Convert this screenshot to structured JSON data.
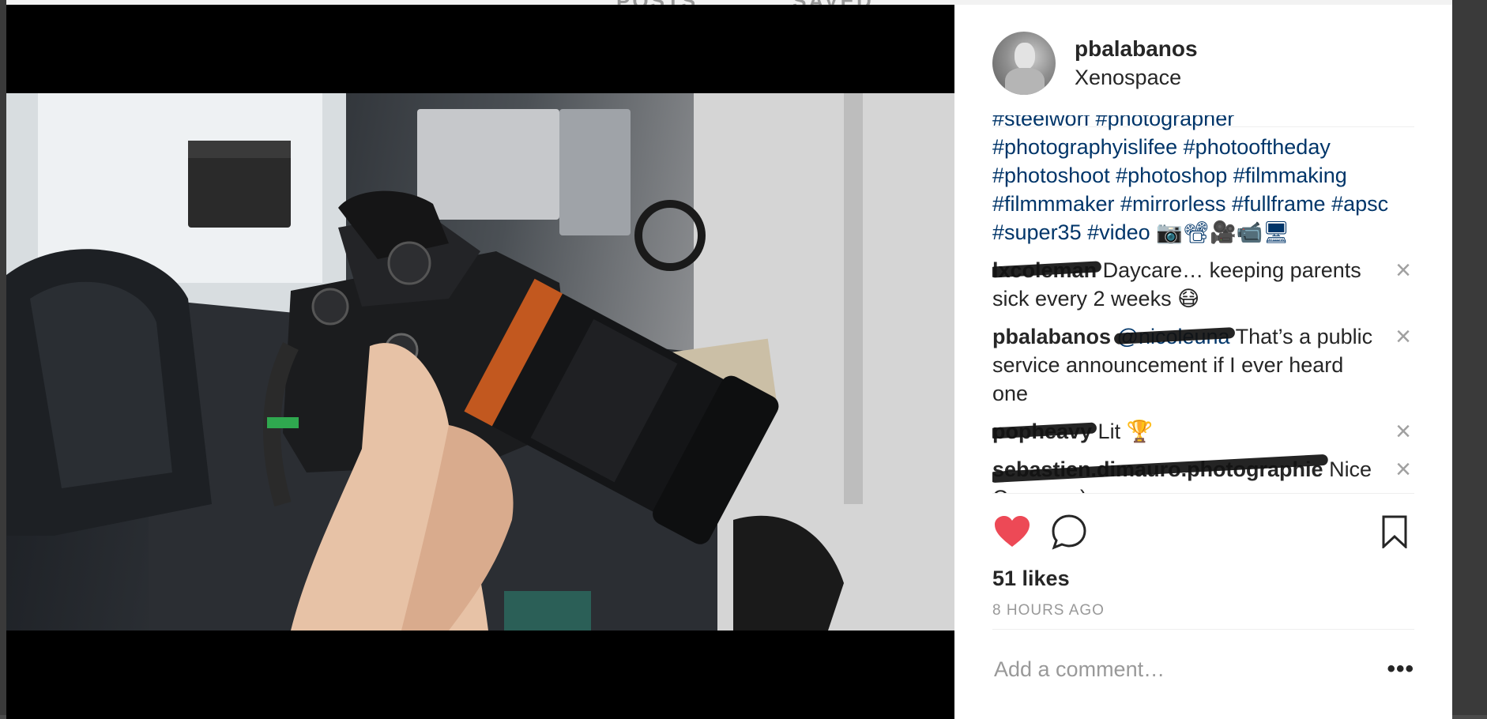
{
  "background": {
    "tabs": [
      "POSTS",
      "SAVED"
    ]
  },
  "post": {
    "username": "pbalabanos",
    "location": "Xenospace"
  },
  "caption": {
    "partial_line": "#steelworf #photographer",
    "lines": [
      "#photographyislifee #photooftheday",
      "#photoshoot #photoshop #filmmaking",
      "#filmmmaker #mirrorless #fullframe #apsc",
      "#super35 #video 📷📽🎥📹🖥"
    ]
  },
  "comments": [
    {
      "author": "lxcoleman",
      "author_redacted": true,
      "mention": "",
      "mention_redacted": false,
      "text": " Daycare… keeping parents sick every 2 weeks 😷"
    },
    {
      "author": "pbalabanos",
      "author_redacted": false,
      "mention": "@nicoleuna",
      "mention_redacted": true,
      "text": " That’s a public service announcement if I ever heard one"
    },
    {
      "author": "popheavy",
      "author_redacted": true,
      "mention": "",
      "mention_redacted": false,
      "text": " Lit 🏆"
    },
    {
      "author": "sebastien.dimauro.photographie",
      "author_redacted": true,
      "mention": "",
      "mention_redacted": false,
      "text": " Nice Camera ;)"
    }
  ],
  "actions": {
    "liked": true,
    "like_color": "#ed4956"
  },
  "likes_label": "51 likes",
  "timestamp": "8 HOURS AGO",
  "add_comment": {
    "placeholder": "Add a comment…",
    "more": "•••"
  }
}
